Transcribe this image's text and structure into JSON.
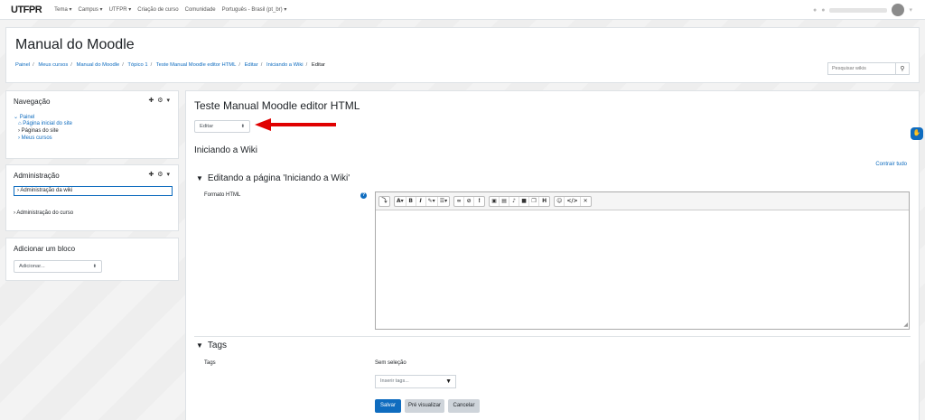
{
  "topbar": {
    "logo": "UTFPR",
    "links": [
      "Tema ▾",
      "Campus ▾",
      "UTFPR ▾",
      "Criação de curso",
      "Comunidade",
      "Português - Brasil (pt_br) ▾"
    ]
  },
  "header": {
    "title": "Manual do Moodle",
    "breadcrumb": [
      "Painel",
      "Meus cursos",
      "Manual do Moodle",
      "Tópico 1",
      "Teste Manual Moodle editor HTML",
      "Editar",
      "Iniciando a Wiki",
      "Editar"
    ],
    "search_placeholder": "Pesquisar wikis"
  },
  "navigation": {
    "title": "Navegação",
    "items": [
      "Painel",
      "Página inicial do site",
      "Páginas do site",
      "Meus cursos"
    ]
  },
  "administration": {
    "title": "Administração",
    "items": [
      "Administração da wiki",
      "Administração do curso"
    ]
  },
  "add_block": {
    "title": "Adicionar um bloco",
    "select_value": "Adicionar..."
  },
  "main": {
    "wiki_title": "Teste Manual Moodle editor HTML",
    "mode_select": "Editar",
    "page_name": "Iniciando a Wiki",
    "collapse_all": "Contrair tudo",
    "editing_section": "Editando a página 'Iniciando a Wiki'",
    "format_label": "Formato HTML",
    "tags_section": "Tags",
    "tags_label": "Tags",
    "tags_none": "Sem seleção",
    "tags_placeholder": "Inserir tags...",
    "buttons": {
      "save": "Salvar",
      "preview": "Pré visualizar",
      "cancel": "Cancelar"
    }
  },
  "colors": {
    "accent": "#0f6cbf",
    "arrow": "#e00000"
  }
}
